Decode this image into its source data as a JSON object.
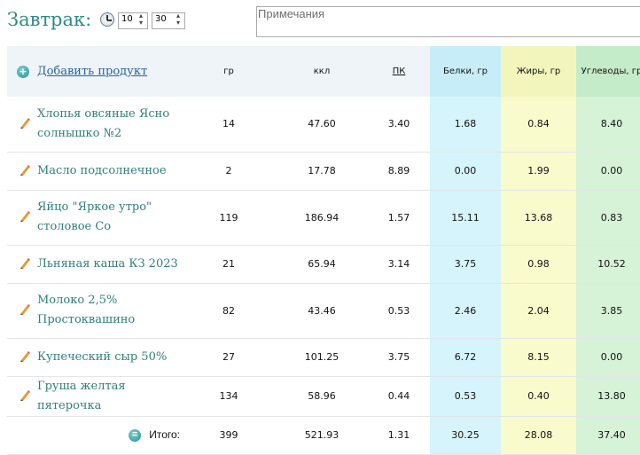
{
  "meal": {
    "title": "Завтрак:",
    "hour": "10",
    "minute": "30",
    "notes_placeholder": "Примечания"
  },
  "header": {
    "add_product": "Добавить продукт",
    "grams": "гр",
    "kcal": "ккл",
    "pk": "ПК",
    "protein": "Белки, гр",
    "fat": "Жиры, гр",
    "carbs": "Углеводы, гр"
  },
  "rows": [
    {
      "name": "Хлопья овсяные Ясно солнышко №2",
      "g": "14",
      "kcal": "47.60",
      "pk": "3.40",
      "prot": "1.68",
      "fat": "0.84",
      "carb": "8.40"
    },
    {
      "name": "Масло подсолнечное",
      "g": "2",
      "kcal": "17.78",
      "pk": "8.89",
      "prot": "0.00",
      "fat": "1.99",
      "carb": "0.00"
    },
    {
      "name": "Яйцо \"Яркое утро\" столовое Со",
      "g": "119",
      "kcal": "186.94",
      "pk": "1.57",
      "prot": "15.11",
      "fat": "13.68",
      "carb": "0.83"
    },
    {
      "name": "Льняная каша КЗ 2023",
      "g": "21",
      "kcal": "65.94",
      "pk": "3.14",
      "prot": "3.75",
      "fat": "0.98",
      "carb": "10.52"
    },
    {
      "name": "Молоко 2,5% Простоквашино",
      "g": "82",
      "kcal": "43.46",
      "pk": "0.53",
      "prot": "2.46",
      "fat": "2.04",
      "carb": "3.85"
    },
    {
      "name": "Купеческий сыр 50%",
      "g": "27",
      "kcal": "101.25",
      "pk": "3.75",
      "prot": "6.72",
      "fat": "8.15",
      "carb": "0.00"
    },
    {
      "name": "Груша желтая пятерочка",
      "g": "134",
      "kcal": "58.96",
      "pk": "0.44",
      "prot": "0.53",
      "fat": "0.40",
      "carb": "13.80"
    }
  ],
  "totals": {
    "label": "Итого:",
    "g": "399",
    "kcal": "521.93",
    "pk": "1.31",
    "prot": "30.25",
    "fat": "28.08",
    "carb": "37.40"
  }
}
